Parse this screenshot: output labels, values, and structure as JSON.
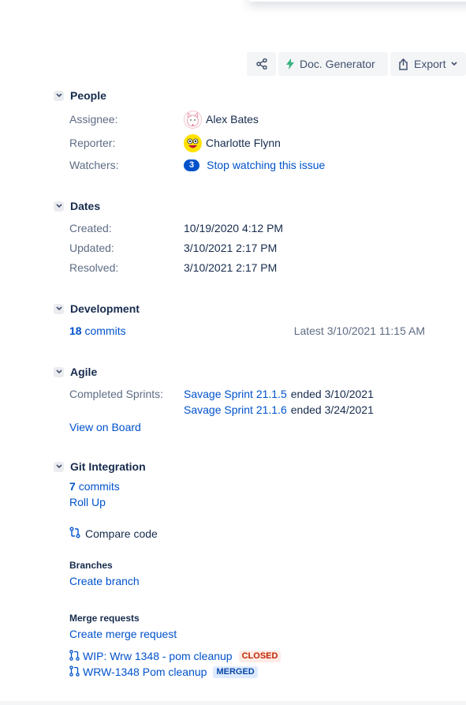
{
  "toolbar": {
    "share_icon": "share-icon",
    "doc_generator_label": "Doc. Generator",
    "doc_generator_color": "#36b37e",
    "export_label": "Export"
  },
  "people": {
    "title": "People",
    "assignee_label": "Assignee:",
    "assignee_name": "Alex Bates",
    "reporter_label": "Reporter:",
    "reporter_name": "Charlotte Flynn",
    "watchers_label": "Watchers:",
    "watchers_count": "3",
    "watchers_action": "Stop watching this issue"
  },
  "dates": {
    "title": "Dates",
    "created_label": "Created:",
    "created_value": "10/19/2020 4:12 PM",
    "updated_label": "Updated:",
    "updated_value": "3/10/2021 2:17 PM",
    "resolved_label": "Resolved:",
    "resolved_value": "3/10/2021 2:17 PM"
  },
  "development": {
    "title": "Development",
    "commits_count": "18",
    "commits_label": "commits",
    "latest": "Latest 3/10/2021 11:15 AM"
  },
  "agile": {
    "title": "Agile",
    "completed_label": "Completed Sprints:",
    "sprints": [
      {
        "name": "Savage Sprint 21.1.5",
        "ended": "ended 3/10/2021"
      },
      {
        "name": "Savage Sprint 21.1.6",
        "ended": "ended 3/24/2021"
      }
    ],
    "view_on_board": "View on Board"
  },
  "git": {
    "title": "Git Integration",
    "commits_count": "7",
    "commits_label": "commits",
    "roll_up": "Roll Up",
    "compare_code": "Compare code",
    "branches_title": "Branches",
    "create_branch": "Create branch",
    "merge_requests_title": "Merge requests",
    "create_merge_request": "Create merge request",
    "merge_requests": [
      {
        "title": "WIP: Wrw 1348 - pom cleanup",
        "status": "CLOSED"
      },
      {
        "title": "WRW-1348 Pom cleanup",
        "status": "MERGED"
      }
    ]
  },
  "colors": {
    "link": "#0052cc",
    "label": "#5e6c84",
    "text": "#172b4d",
    "closed_bg": "#ffebe6",
    "closed_fg": "#bf2600",
    "merged_bg": "#deebff",
    "merged_fg": "#0747a6"
  }
}
